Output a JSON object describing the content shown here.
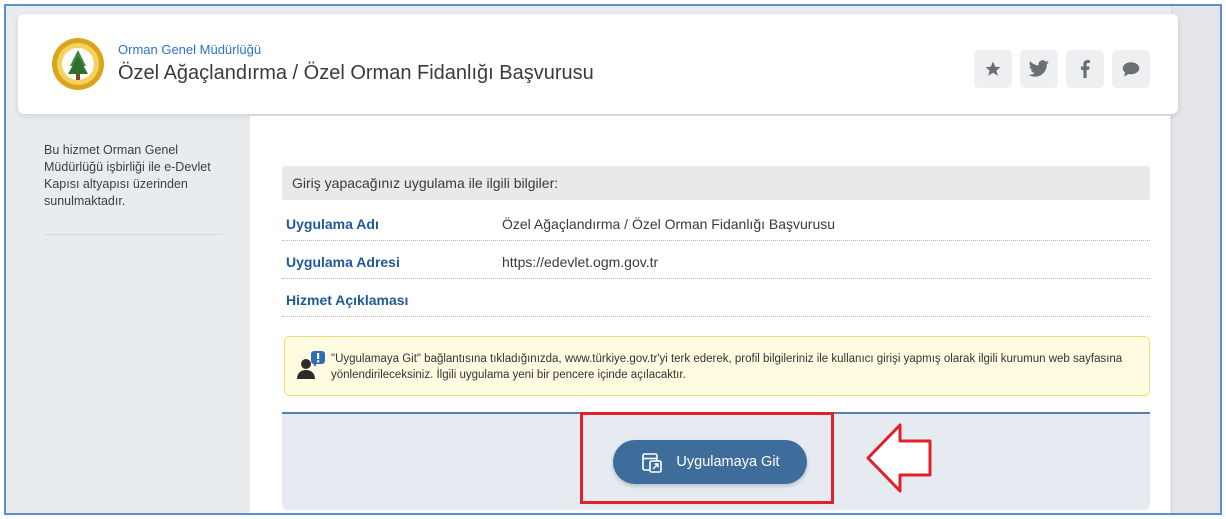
{
  "header": {
    "org_name": "Orman Genel Müdürlüğü",
    "title": "Özel Ağaçlandırma / Özel Orman Fidanlığı Başvurusu",
    "logo_icon": "ogm-logo-icon",
    "social_icons": [
      "star-icon",
      "twitter-icon",
      "facebook-icon",
      "comment-icon"
    ]
  },
  "sidebar": {
    "info": "Bu hizmet Orman Genel Müdürlüğü işbirliği ile e-Devlet Kapısı altyapısı üzerinden sunulmaktadır."
  },
  "main": {
    "info_heading": "Giriş yapacağınız uygulama ile ilgili bilgiler:",
    "rows": [
      {
        "label": "Uygulama Adı",
        "value": "Özel Ağaçlandırma / Özel Orman Fidanlığı Başvurusu"
      },
      {
        "label": "Uygulama Adresi",
        "value": "https://edevlet.ogm.gov.tr"
      },
      {
        "label": "Hizmet Açıklaması",
        "value": ""
      }
    ],
    "notice": "\"Uygulamaya Git\" bağlantısına tıkladığınızda, www.türkiye.gov.tr'yi terk ederek, profil bilgileriniz ile kullanıcı girişi yapmış olarak ilgili kurumun web sayfasına yönlendirileceksiniz. İlgili uygulama yeni bir pencere içinde açılacaktır.",
    "go_button": "Uygulamaya Git"
  },
  "colors": {
    "brand_link": "#2f72c8",
    "label_blue": "#1f5a96",
    "button": "#3e6d9c",
    "highlight": "#e0202a"
  }
}
